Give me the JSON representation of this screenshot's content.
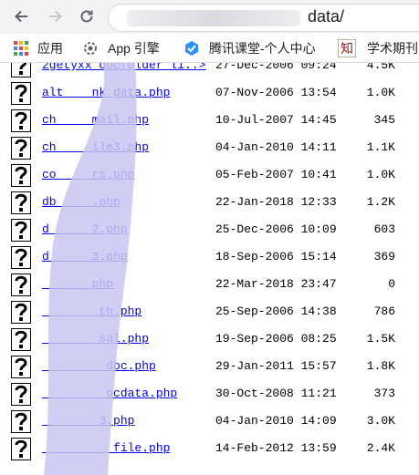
{
  "browser": {
    "url_visible_suffix": "data/"
  },
  "bookmarks": [
    {
      "label": "应用",
      "icon": "apps-grid-icon"
    },
    {
      "label": "App 引擎",
      "icon": "gear-icon"
    },
    {
      "label": "腾讯课堂-个人中心",
      "icon": "tencent-classroom-icon"
    },
    {
      "label": "学术期刊",
      "icon": "zhi-icon"
    }
  ],
  "files": [
    {
      "name": "2getyxx_docfolder_li..>",
      "date": "27-Dec-2006 09:24",
      "size": "4.5K"
    },
    {
      "name": "alt____nk_data.php",
      "date": "07-Nov-2006 13:54",
      "size": "1.0K"
    },
    {
      "name": "ch_____mail.php",
      "date": "10-Jul-2007 14:45",
      "size": "345"
    },
    {
      "name": "ch_____ile3.php",
      "date": "04-Jan-2010 14:11",
      "size": "1.1K"
    },
    {
      "name": "co_____rs.php",
      "date": "05-Feb-2007 10:41",
      "size": "1.0K"
    },
    {
      "name": "db_____.php",
      "date": "22-Jan-2018 12:33",
      "size": "1.2K"
    },
    {
      "name": "d______2.php",
      "date": "25-Dec-2006 10:09",
      "size": "603"
    },
    {
      "name": "d______3.php",
      "date": "18-Sep-2006 15:14",
      "size": "369"
    },
    {
      "name": "_______php",
      "date": "22-Mar-2018 23:47",
      "size": "0"
    },
    {
      "name": "________th.php",
      "date": "25-Sep-2006 14:38",
      "size": "786"
    },
    {
      "name": "________sql.php",
      "date": "19-Sep-2006 08:25",
      "size": "1.5K"
    },
    {
      "name": "_________dbc.php",
      "date": "29-Jan-2011 15:57",
      "size": "1.8K"
    },
    {
      "name": "_________ocdata.php",
      "date": "30-Oct-2008 11:21",
      "size": "373"
    },
    {
      "name": "________3.php",
      "date": "04-Jan-2010 14:09",
      "size": "3.0K"
    },
    {
      "name": "__________file.php",
      "date": "14-Feb-2012 13:59",
      "size": "2.4K"
    }
  ]
}
